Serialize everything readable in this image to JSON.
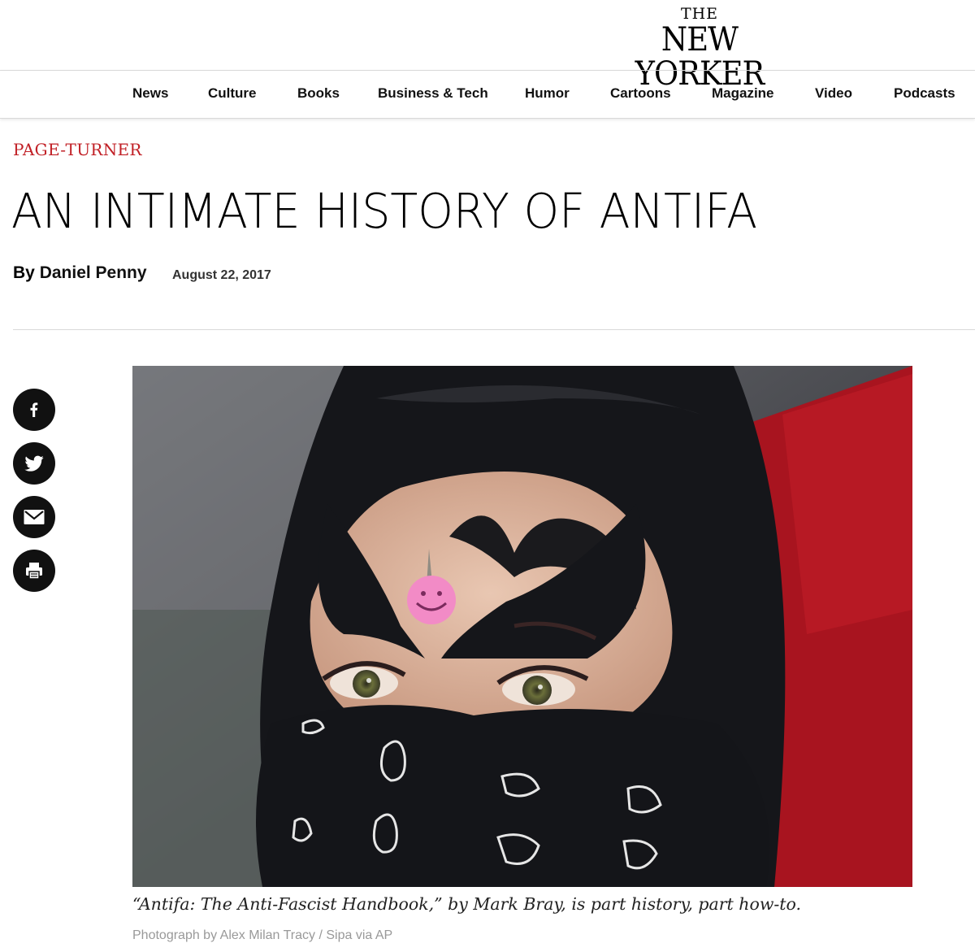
{
  "masthead": {
    "logo_the": "THE",
    "logo_main": "NEW YORKER"
  },
  "nav": {
    "items": [
      "News",
      "Culture",
      "Books",
      "Business & Tech",
      "Humor",
      "Cartoons",
      "Magazine",
      "Video",
      "Podcasts"
    ]
  },
  "article": {
    "rubric": "PAGE-TURNER",
    "headline": "AN INTIMATE HISTORY OF ANTIFA",
    "byline_prefix": "By ",
    "author": "Daniel Penny",
    "date": "August 22, 2017",
    "caption": "“Antifa: The Anti-Fascist Handbook,” by Mark Bray, is part history, part how-to.",
    "credit": "Photograph by Alex Milan Tracy / Sipa via AP"
  },
  "share": {
    "icons": [
      "facebook-icon",
      "twitter-icon",
      "email-icon",
      "print-icon"
    ]
  },
  "colors": {
    "rubric": "#c12026",
    "share_bg": "#111111",
    "rule": "#d9d9d9"
  }
}
